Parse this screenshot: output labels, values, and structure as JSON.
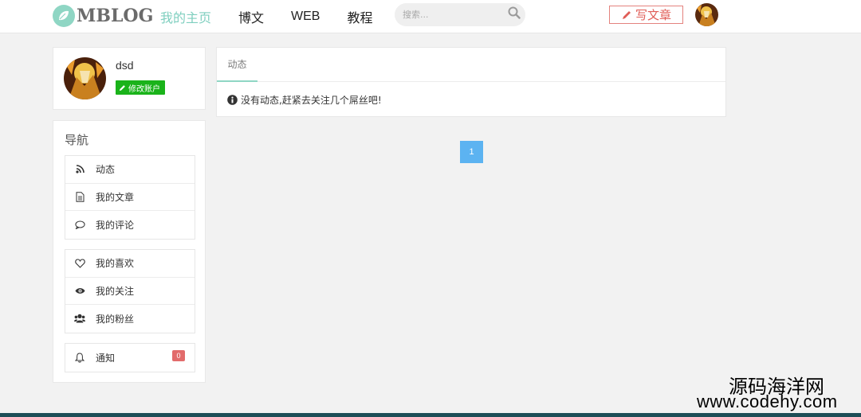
{
  "header": {
    "logo_text": "MBLOG",
    "nav": [
      {
        "label": "我的主页",
        "active": true
      },
      {
        "label": "博文",
        "active": false
      },
      {
        "label": "WEB",
        "active": false
      },
      {
        "label": "教程",
        "active": false
      }
    ],
    "search_placeholder": "搜索...",
    "write_label": "写文章"
  },
  "profile": {
    "username": "dsd",
    "edit_label": "修改账户"
  },
  "sidebar": {
    "title": "导航",
    "groups": [
      [
        {
          "label": "动态",
          "icon": "rss-icon"
        },
        {
          "label": "我的文章",
          "icon": "document-icon"
        },
        {
          "label": "我的评论",
          "icon": "comment-icon"
        }
      ],
      [
        {
          "label": "我的喜欢",
          "icon": "heart-icon"
        },
        {
          "label": "我的关注",
          "icon": "eye-icon"
        },
        {
          "label": "我的粉丝",
          "icon": "users-icon"
        }
      ],
      [
        {
          "label": "通知",
          "icon": "bell-icon",
          "badge": "0"
        }
      ]
    ]
  },
  "main": {
    "tab_label": "动态",
    "empty_message": "没有动态,赶紧去关注几个屌丝吧!",
    "pagination": {
      "current": "1"
    }
  },
  "watermark": {
    "line1": "源码海洋网",
    "line2": "www.codehy.com"
  },
  "colors": {
    "accent": "#7fcfbf",
    "write_border": "#e4827e",
    "edit_green": "#1ab31a",
    "badge_red": "#e26b6b",
    "pager_blue": "#5cb3f1"
  }
}
